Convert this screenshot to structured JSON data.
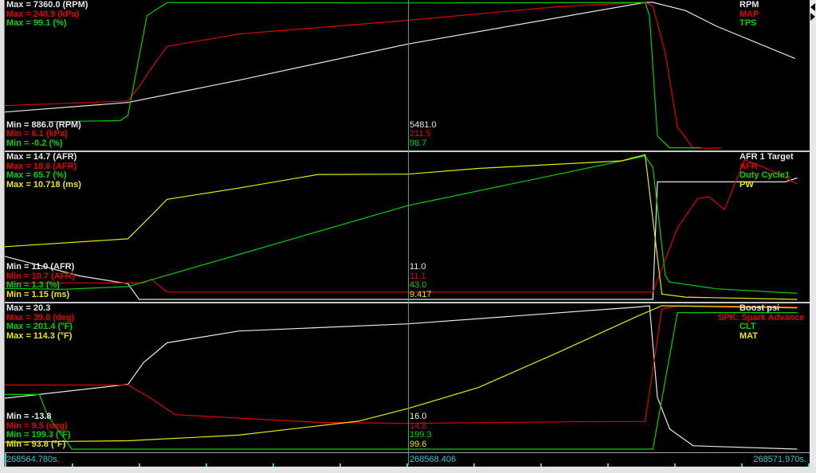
{
  "time_axis": {
    "start_label": "268564.780s.",
    "cursor_label": "268568.406",
    "end_label": "268571.970s.",
    "duration_s": 7.19,
    "cursor_t": 3.626
  },
  "chart_data": [
    {
      "type": "line",
      "pane": "engine",
      "series": [
        {
          "name": "RPM",
          "color": "#e8e8e8",
          "min": 886.0,
          "max": 7360.0,
          "max_label": "Max = 7360.0 (RPM)",
          "min_label": "Min = 886.0 (RPM)",
          "cursor_value": "5481.0",
          "points": [
            [
              0,
              2490
            ],
            [
              1.1,
              2914
            ],
            [
              2.09,
              3900
            ],
            [
              3.6,
              5510
            ],
            [
              5.72,
              7360
            ],
            [
              5.79,
              7360
            ],
            [
              6.08,
              7000
            ],
            [
              6.36,
              6300
            ],
            [
              7.06,
              4870
            ]
          ]
        },
        {
          "name": "MAP",
          "color": "#e00000",
          "min": 6.1,
          "max": 240.9,
          "max_label": "Max = 240.9 (kPa)",
          "min_label": "Min = 6.1 (kPa)",
          "cursor_value": "211.5",
          "points": [
            [
              0,
              74.5
            ],
            [
              1.1,
              82
            ],
            [
              1.2,
              105
            ],
            [
              1.31,
              135
            ],
            [
              1.45,
              170
            ],
            [
              2.09,
              190
            ],
            [
              3.6,
              212
            ],
            [
              4.94,
              234
            ],
            [
              5.72,
              241
            ],
            [
              5.79,
              235
            ],
            [
              5.9,
              160
            ],
            [
              6.01,
              40
            ],
            [
              6.15,
              6.1
            ],
            [
              6.4,
              6.1
            ]
          ]
        },
        {
          "name": "TPS",
          "color": "#00d000",
          "min": -0.2,
          "max": 99.1,
          "max_label": "Max = 99.1 (%)",
          "min_label": "Min = -0.2 (%)",
          "cursor_value": "98.7",
          "points": [
            [
              0.38,
              17.8
            ],
            [
              1.03,
              18.5
            ],
            [
              1.1,
              22
            ],
            [
              1.2,
              62
            ],
            [
              1.27,
              90
            ],
            [
              1.45,
              99
            ],
            [
              3.6,
              98.7
            ],
            [
              5.72,
              99
            ],
            [
              5.76,
              90
            ],
            [
              5.83,
              8
            ],
            [
              5.94,
              0
            ],
            [
              6.22,
              0
            ]
          ]
        }
      ]
    },
    {
      "type": "line",
      "pane": "fuel",
      "series": [
        {
          "name": "AFR 1 Target",
          "color": "#e8e8e8",
          "min": 11.0,
          "max": 14.7,
          "max_label": "Max = 14.7 (AFR)",
          "min_label": "Min = 11.0 (AFR)",
          "cursor_value": "11.0",
          "points": [
            [
              0,
              12.1
            ],
            [
              0.67,
              11.6
            ],
            [
              1.1,
              11.4
            ],
            [
              1.2,
              11.0
            ],
            [
              5.79,
              11.0
            ],
            [
              5.83,
              14.0
            ],
            [
              6.97,
              14.0
            ],
            [
              7.08,
              14.1
            ]
          ]
        },
        {
          "name": "AFR",
          "color": "#e00000",
          "min": 10.7,
          "max": 18.6,
          "max_label": "Max = 18.6 (AFR)",
          "min_label": "Min = 10.7 (AFR)",
          "cursor_value": "11.1",
          "points": [
            [
              0,
              11.6
            ],
            [
              1.24,
              11.6
            ],
            [
              1.31,
              11.8
            ],
            [
              1.45,
              11.1
            ],
            [
              5.79,
              11.1
            ],
            [
              6.01,
              14.6
            ],
            [
              6.19,
              16.2
            ],
            [
              6.29,
              16.3
            ],
            [
              6.43,
              15.6
            ],
            [
              6.61,
              18.3
            ],
            [
              6.86,
              17.7
            ],
            [
              7.08,
              17.0
            ]
          ]
        },
        {
          "name": "Duty Cycle1",
          "color": "#00d000",
          "min": 1.3,
          "max": 65.7,
          "max_label": "Max = 65.7 (%)",
          "min_label": "Min = 1.3 (%)",
          "cursor_value": "43.0",
          "points": [
            [
              0,
              6.2
            ],
            [
              0.53,
              5.8
            ],
            [
              1.1,
              7.0
            ],
            [
              3.6,
              43.0
            ],
            [
              5.72,
              65.0
            ],
            [
              5.79,
              60
            ],
            [
              5.9,
              12
            ],
            [
              5.94,
              9
            ],
            [
              6.36,
              6
            ],
            [
              7.08,
              4
            ]
          ]
        },
        {
          "name": "PW",
          "color": "#e8e800",
          "min": 1.15,
          "max": 10.718,
          "max_label": "Max = 10.718 (ms)",
          "min_label": "Min = 1.15 (ms)",
          "cursor_value": "9.417",
          "points": [
            [
              0,
              4.63
            ],
            [
              1.1,
              5.15
            ],
            [
              1.31,
              6.7
            ],
            [
              1.45,
              7.76
            ],
            [
              2.09,
              8.5
            ],
            [
              2.8,
              9.4
            ],
            [
              3.6,
              9.417
            ],
            [
              4.23,
              9.8
            ],
            [
              5.51,
              10.3
            ],
            [
              5.72,
              10.7
            ],
            [
              5.87,
              1.5
            ],
            [
              6.08,
              1.3
            ],
            [
              7.08,
              1.15
            ]
          ]
        }
      ]
    },
    {
      "type": "line",
      "pane": "ignition",
      "series": [
        {
          "name": "Boost psi",
          "color": "#e8e8e8",
          "min": -13.8,
          "max": 20.3,
          "max_label": "Max = 20.3",
          "min_label": "Min = -13.8",
          "cursor_value": "16.0",
          "points": [
            [
              0,
              -1.7
            ],
            [
              1.1,
              1.6
            ],
            [
              1.24,
              6.8
            ],
            [
              1.45,
              11.5
            ],
            [
              2.09,
              14.3
            ],
            [
              3.6,
              16.0
            ],
            [
              5.65,
              20.0
            ],
            [
              5.76,
              20.3
            ],
            [
              5.83,
              -1.5
            ],
            [
              5.94,
              -9
            ],
            [
              6.15,
              -13
            ],
            [
              7.08,
              -13.8
            ]
          ]
        },
        {
          "name": "SPK: Spark Advance",
          "color": "#e00000",
          "min": 9.5,
          "max": 39.0,
          "max_label": "Max = 39.0 (deg)",
          "min_label": "Min = 9.5 (deg)",
          "cursor_value": "14.8",
          "points": [
            [
              0,
              22.7
            ],
            [
              1.1,
              22.7
            ],
            [
              1.31,
              19.9
            ],
            [
              1.52,
              16.6
            ],
            [
              2.8,
              15.0
            ],
            [
              3.6,
              14.8
            ],
            [
              4.94,
              15.1
            ],
            [
              5.72,
              15.2
            ],
            [
              5.87,
              38.3
            ],
            [
              6.01,
              39.0
            ],
            [
              7.08,
              38.8
            ]
          ]
        },
        {
          "name": "CLT",
          "color": "#00d000",
          "min": 199.3,
          "max": 201.4,
          "max_label": "Max = 201.4 (°F)",
          "min_label": "Min = 199.3 (°F)",
          "cursor_value": "199.3",
          "points": [
            [
              0,
              200.1
            ],
            [
              0.31,
              200.1
            ],
            [
              0.38,
              199.8
            ],
            [
              0.6,
              199.3
            ],
            [
              5.79,
              199.3
            ],
            [
              6.01,
              201.3
            ],
            [
              7.08,
              201.3
            ]
          ]
        },
        {
          "name": "MAT",
          "color": "#e8e800",
          "min": 93.8,
          "max": 114.3,
          "max_label": "Max = 114.3 (°F)",
          "min_label": "Min = 93.8 (°F)",
          "cursor_value": "99.6",
          "points": [
            [
              0,
              94.8
            ],
            [
              1.1,
              95.0
            ],
            [
              2.09,
              95.8
            ],
            [
              3.16,
              97.8
            ],
            [
              3.6,
              99.6
            ],
            [
              4.23,
              102.6
            ],
            [
              4.94,
              107.6
            ],
            [
              5.65,
              112.8
            ],
            [
              5.87,
              114.3
            ],
            [
              7.08,
              114.0
            ]
          ]
        }
      ]
    }
  ]
}
